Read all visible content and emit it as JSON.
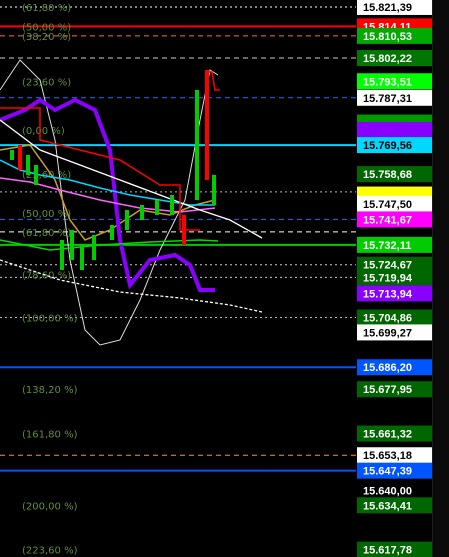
{
  "chart_data": {
    "type": "candlestick-overlay",
    "y_axis": {
      "min": 15615,
      "max": 15824,
      "tick_labels": [
        {
          "value": 15821.39,
          "text": "15.821,39",
          "bg": "#ffffff",
          "fg": "#000000"
        },
        {
          "value": 15814.11,
          "text": "15.814,11",
          "bg": "#ff0000",
          "fg": "#ffffff"
        },
        {
          "value": 15810.53,
          "text": "15.810,53",
          "bg": "#00aa00",
          "fg": "#ffffff"
        },
        {
          "value": 15802.22,
          "text": "15.802,22",
          "bg": "#007700",
          "fg": "#ffffff"
        },
        {
          "value": 15793.51,
          "text": "15.793,51",
          "bg": "#00ff00",
          "fg": "#ffffff"
        },
        {
          "value": 15787.31,
          "text": "15.787,31",
          "bg": "#ffffff",
          "fg": "#000000"
        },
        {
          "value": 15778.0,
          "text": "",
          "bg": "#009900",
          "fg": "#ffffff"
        },
        {
          "value": 15775.2,
          "text": "",
          "bg": "#8a00ff",
          "fg": "#ffffff"
        },
        {
          "value": 15769.56,
          "text": "15.769,56",
          "bg": "#00d8ff",
          "fg": "#000000"
        },
        {
          "value": 15758.68,
          "text": "15.758,68",
          "bg": "#006600",
          "fg": "#ffffff"
        },
        {
          "value": 15751.0,
          "text": "",
          "bg": "#ffff00",
          "fg": "#000000"
        },
        {
          "value": 15747.5,
          "text": "15.747,50",
          "bg": "#ffffff",
          "fg": "#000000"
        },
        {
          "value": 15741.67,
          "text": "15.741,67",
          "bg": "#ff00ff",
          "fg": "#ffffff"
        },
        {
          "value": 15732.11,
          "text": "15.732,11",
          "bg": "#00cc00",
          "fg": "#ffffff"
        },
        {
          "value": 15724.67,
          "text": "15.724,67",
          "bg": "#006600",
          "fg": "#ffffff"
        },
        {
          "value": 15719.94,
          "text": "15.719,94",
          "bg": "#006600",
          "fg": "#ffffff"
        },
        {
          "value": 15713.94,
          "text": "15.713,94",
          "bg": "#8a00ff",
          "fg": "#ffffff"
        },
        {
          "value": 15704.86,
          "text": "15.704,86",
          "bg": "#006600",
          "fg": "#ffffff"
        },
        {
          "value": 15699.27,
          "text": "15.699,27",
          "bg": "#ffffff",
          "fg": "#000000"
        },
        {
          "value": 15686.2,
          "text": "15.686,20",
          "bg": "#0055ff",
          "fg": "#ffffff"
        },
        {
          "value": 15677.95,
          "text": "15.677,95",
          "bg": "#006600",
          "fg": "#ffffff"
        },
        {
          "value": 15661.32,
          "text": "15.661,32",
          "bg": "#006600",
          "fg": "#ffffff"
        },
        {
          "value": 15653.18,
          "text": "15.653,18",
          "bg": "#ffffff",
          "fg": "#000000"
        },
        {
          "value": 15647.39,
          "text": "15.647,39",
          "bg": "#0055ff",
          "fg": "#ffffff"
        },
        {
          "value": 15640.0,
          "text": "15.640,00",
          "bg": "#000000",
          "fg": "#ffffff"
        },
        {
          "value": 15634.41,
          "text": "15.634,41",
          "bg": "#006600",
          "fg": "#ffffff"
        },
        {
          "value": 15617.78,
          "text": "15.617,78",
          "bg": "#006600",
          "fg": "#ffffff"
        }
      ]
    },
    "fib_levels": [
      {
        "text": "(61,80 %)",
        "value": 15821.39
      },
      {
        "text": "(50,00 %)",
        "value": 15814.11
      },
      {
        "text": "(38,20 %)",
        "value": 15810.53
      },
      {
        "text": "(23,60 %)",
        "value": 15793.51
      },
      {
        "text": "(0,00 %)",
        "value": 15775.2
      },
      {
        "text": "(23,60 %)",
        "value": 15758.68
      },
      {
        "text": "(50,00 %)",
        "value": 15744.0
      },
      {
        "text": "(61,80 %)",
        "value": 15737.0
      },
      {
        "text": "(78,60 %)",
        "value": 15721.0
      },
      {
        "text": "(100,00 %)",
        "value": 15704.86
      },
      {
        "text": "(138,20 %)",
        "value": 15677.95
      },
      {
        "text": "(161,80 %)",
        "value": 15661.32
      },
      {
        "text": "(200,00 %)",
        "value": 15634.41
      },
      {
        "text": "(223,60 %)",
        "value": 15617.78
      }
    ],
    "horizontal_lines": [
      {
        "value": 15821.39,
        "color": "#ffffff",
        "style": "dotted"
      },
      {
        "value": 15814.11,
        "color": "#ff0000",
        "style": "solid"
      },
      {
        "value": 15810.53,
        "color": "#ff6a3a",
        "style": "dashed"
      },
      {
        "value": 15802.22,
        "color": "#cccccc",
        "style": "dashed"
      },
      {
        "value": 15787.31,
        "color": "#1e6fff",
        "style": "dashed"
      },
      {
        "value": 15769.56,
        "color": "#00d8ff",
        "style": "solid"
      },
      {
        "value": 15752.0,
        "color": "#bbbbbb",
        "style": "dotted"
      },
      {
        "value": 15741.67,
        "color": "#1e6fff",
        "style": "dashed"
      },
      {
        "value": 15737.0,
        "color": "#ffffff",
        "style": "dashed"
      },
      {
        "value": 15732.11,
        "color": "#00cc00",
        "style": "solid"
      },
      {
        "value": 15724.67,
        "color": "#cccccc",
        "style": "dotted"
      },
      {
        "value": 15719.94,
        "color": "#cccccc",
        "style": "dotted"
      },
      {
        "value": 15704.86,
        "color": "#bbbbbb",
        "style": "dotted"
      },
      {
        "value": 15686.2,
        "color": "#0055ff",
        "style": "solid"
      },
      {
        "value": 15653.18,
        "color": "#ff8a40",
        "style": "dashed"
      },
      {
        "value": 15647.39,
        "color": "#0055ff",
        "style": "solid"
      }
    ]
  }
}
